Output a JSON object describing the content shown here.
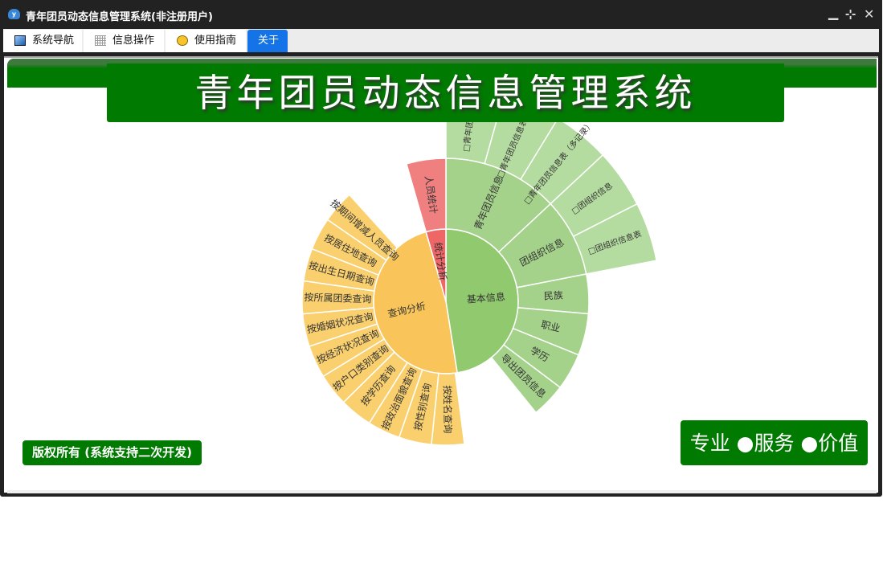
{
  "window": {
    "title": "青年团员动态信息管理系统(非注册用户)",
    "controls": [
      "minimize",
      "restore",
      "close"
    ]
  },
  "tabs": [
    {
      "label": "系统导航",
      "icon": "monitor-icon"
    },
    {
      "label": "信息操作",
      "icon": "grid-icon"
    },
    {
      "label": "使用指南",
      "icon": "help-icon"
    },
    {
      "label": "关于",
      "active": true
    }
  ],
  "banner": {
    "title": "青年团员动态信息管理系统"
  },
  "footer": {
    "copyright": "版权所有 (系统支持二次开发)",
    "slogan": "专业 ●服务 ●价值"
  },
  "colors": {
    "green": "#007a00",
    "tab_active": "#1473e6"
  },
  "chart_data": {
    "type": "sunburst",
    "unit": "angular share (degrees, estimated)",
    "nodes": [
      {
        "name": "基本信息",
        "color": "#91c96f",
        "value": 171,
        "children": [
          {
            "name": "青年团员信息",
            "value": 47,
            "children": [
              {
                "name": "□青年团员信...",
                "value": 15.7
              },
              {
                "name": "□青年团员信息表（单...",
                "value": 15.8
              },
              {
                "name": "□青年团员信息表（多记录）",
                "value": 15.5
              }
            ]
          },
          {
            "name": "团组织信息",
            "value": 32,
            "children": [
              {
                "name": "□团组织信息",
                "value": 16
              },
              {
                "name": "□团组织信息表",
                "value": 16
              }
            ]
          },
          {
            "name": "民族",
            "value": 16
          },
          {
            "name": "职业",
            "value": 17
          },
          {
            "name": "学历",
            "value": 15
          },
          {
            "name": "导出团员信息",
            "value": 14
          }
        ]
      },
      {
        "name": "查询分析",
        "color": "#f9c55a",
        "value": 173,
        "children": [
          {
            "name": "按姓名查询",
            "value": 13.2
          },
          {
            "name": "按性别查询",
            "value": 13.2
          },
          {
            "name": "按政治面貌查询",
            "value": 13.2
          },
          {
            "name": "按学历查询",
            "value": 13.2
          },
          {
            "name": "按户口类别查询",
            "value": 13.2
          },
          {
            "name": "按经济状况查询",
            "value": 13.2
          },
          {
            "name": "按婚姻状况查询",
            "value": 13.2
          },
          {
            "name": "按所属团委查询",
            "value": 13.2
          },
          {
            "name": "按出生日期查询",
            "value": 13.2
          },
          {
            "name": "按居住地查询",
            "value": 13.2
          },
          {
            "name": "按期间增减人员查询",
            "value": 13.2
          }
        ]
      },
      {
        "name": "统计分析",
        "color": "#ee6666",
        "value": 16,
        "children": [
          {
            "name": "人员统计",
            "value": 16
          }
        ]
      }
    ]
  }
}
